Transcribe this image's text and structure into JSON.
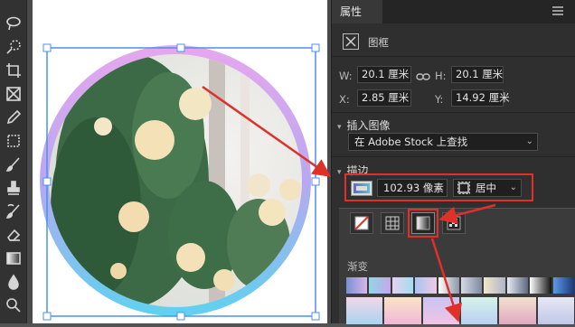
{
  "toolbar": {
    "tools": [
      "lasso-icon",
      "quick-select-icon",
      "crop-icon",
      "frame-icon",
      "eyedropper-icon",
      "patch-icon",
      "brush-icon",
      "stamp-icon",
      "history-brush-icon",
      "eraser-icon",
      "gradient-icon",
      "blur-icon",
      "dodge-icon"
    ]
  },
  "panel": {
    "tab_label": "属性",
    "frame_label": "图框",
    "w_label": "W:",
    "w_value": "20.1 厘米",
    "h_label": "H:",
    "h_value": "20.1 厘米",
    "x_label": "X:",
    "x_value": "2.85 厘米",
    "y_label": "Y:",
    "y_value": "14.92 厘米",
    "insert_section": "插入图像",
    "adobe_stock_option": "在 Adobe Stock 上查找",
    "stroke_section": "描边",
    "stroke_width": "102.93 像素",
    "stroke_align": "居中",
    "gradient_label": "渐变"
  },
  "colors": {
    "highlight": "#e0302a",
    "stroke_gradient_start": "#e6a7ee",
    "stroke_gradient_end": "#5ed2ef"
  }
}
